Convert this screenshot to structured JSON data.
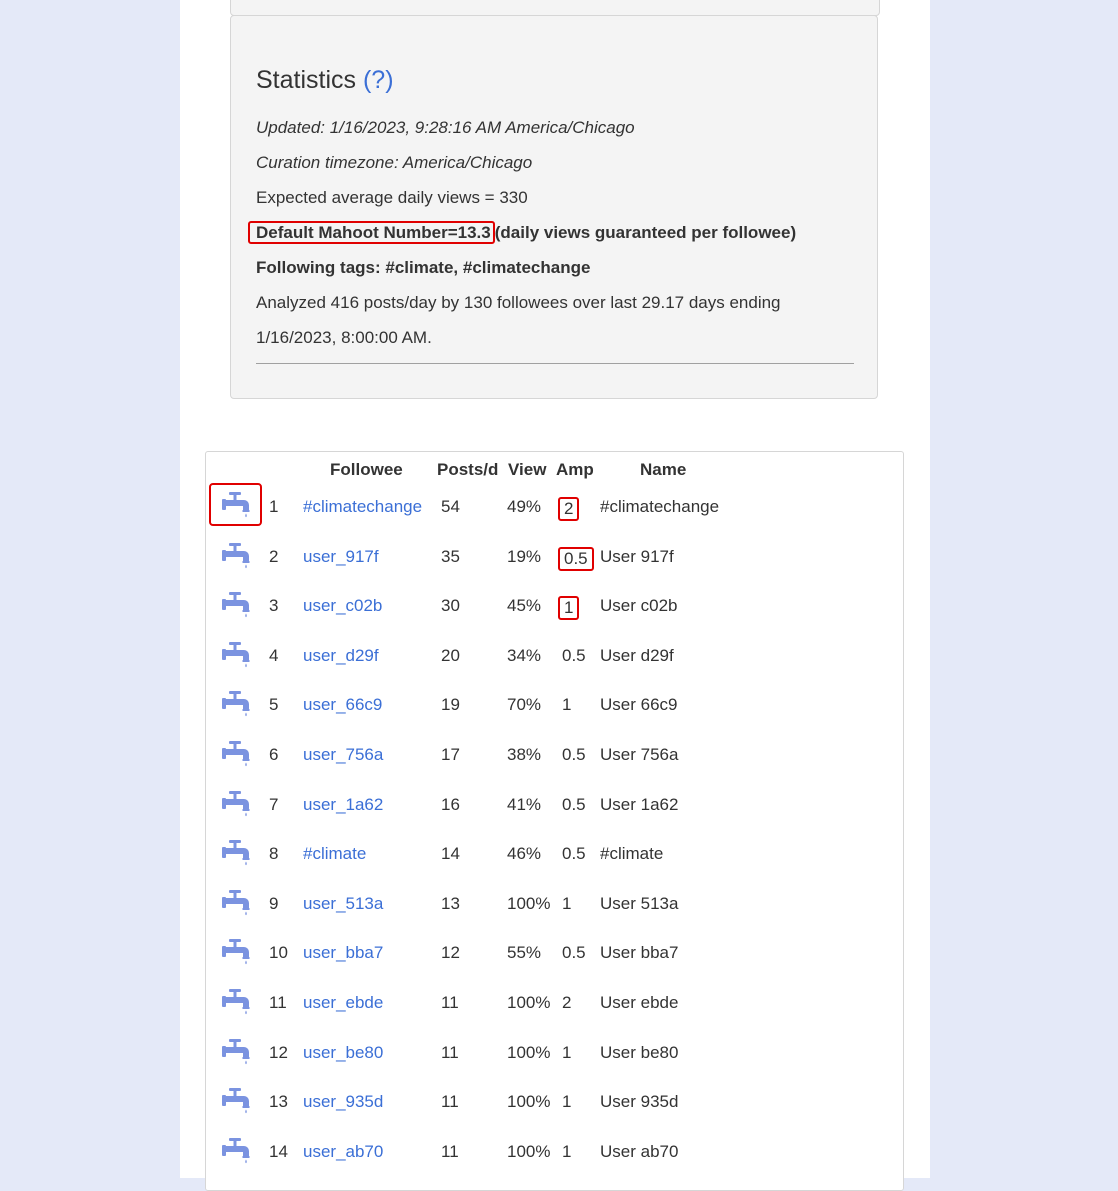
{
  "stats": {
    "title": "Statistics",
    "help_link": "(?)",
    "updated": "Updated: 1/16/2023, 9:28:16 AM America/Chicago",
    "curation_timezone": "Curation timezone: America/Chicago",
    "expected_views": "Expected average daily views = 330",
    "mahoot_number": "Default Mahoot Number=13.3",
    "mahoot_note": "(daily views guaranteed per followee)",
    "following_tags": "Following tags: #climate, #climatechange",
    "analyzed_line1": "Analyzed 416 posts/day by 130 followees over last 29.17 days ending",
    "analyzed_line2": "1/16/2023, 8:00:00 AM."
  },
  "table": {
    "headers": {
      "followee": "Followee",
      "posts": "Posts/d",
      "view": "View",
      "amp": "Amp",
      "name": "Name"
    },
    "rows": [
      {
        "rank": "1",
        "followee": "#climatechange",
        "posts": "54",
        "view": "49%",
        "amp": "2",
        "name": "#climatechange"
      },
      {
        "rank": "2",
        "followee": "user_917f",
        "posts": "35",
        "view": "19%",
        "amp": "0.5",
        "name": "User 917f"
      },
      {
        "rank": "3",
        "followee": "user_c02b",
        "posts": "30",
        "view": "45%",
        "amp": "1",
        "name": "User c02b"
      },
      {
        "rank": "4",
        "followee": "user_d29f",
        "posts": "20",
        "view": "34%",
        "amp": "0.5",
        "name": "User d29f"
      },
      {
        "rank": "5",
        "followee": "user_66c9",
        "posts": "19",
        "view": "70%",
        "amp": "1",
        "name": "User 66c9"
      },
      {
        "rank": "6",
        "followee": "user_756a",
        "posts": "17",
        "view": "38%",
        "amp": "0.5",
        "name": "User 756a"
      },
      {
        "rank": "7",
        "followee": "user_1a62",
        "posts": "16",
        "view": "41%",
        "amp": "0.5",
        "name": "User 1a62"
      },
      {
        "rank": "8",
        "followee": "#climate",
        "posts": "14",
        "view": "46%",
        "amp": "0.5",
        "name": "#climate"
      },
      {
        "rank": "9",
        "followee": "user_513a",
        "posts": "13",
        "view": "100%",
        "amp": "1",
        "name": "User 513a"
      },
      {
        "rank": "10",
        "followee": "user_bba7",
        "posts": "12",
        "view": "55%",
        "amp": "0.5",
        "name": "User bba7"
      },
      {
        "rank": "11",
        "followee": "user_ebde",
        "posts": "11",
        "view": "100%",
        "amp": "2",
        "name": "User ebde"
      },
      {
        "rank": "12",
        "followee": "user_be80",
        "posts": "11",
        "view": "100%",
        "amp": "1",
        "name": "User be80"
      },
      {
        "rank": "13",
        "followee": "user_935d",
        "posts": "11",
        "view": "100%",
        "amp": "1",
        "name": "User 935d"
      },
      {
        "rank": "14",
        "followee": "user_ab70",
        "posts": "11",
        "view": "100%",
        "amp": "1",
        "name": "User ab70"
      }
    ]
  },
  "colors": {
    "page_bg": "#e4e9f8",
    "link": "#3b6fd6",
    "tap_icon": "#7b93e0",
    "highlight": "#e00000"
  },
  "icons": {
    "row_button": "faucet-icon"
  }
}
